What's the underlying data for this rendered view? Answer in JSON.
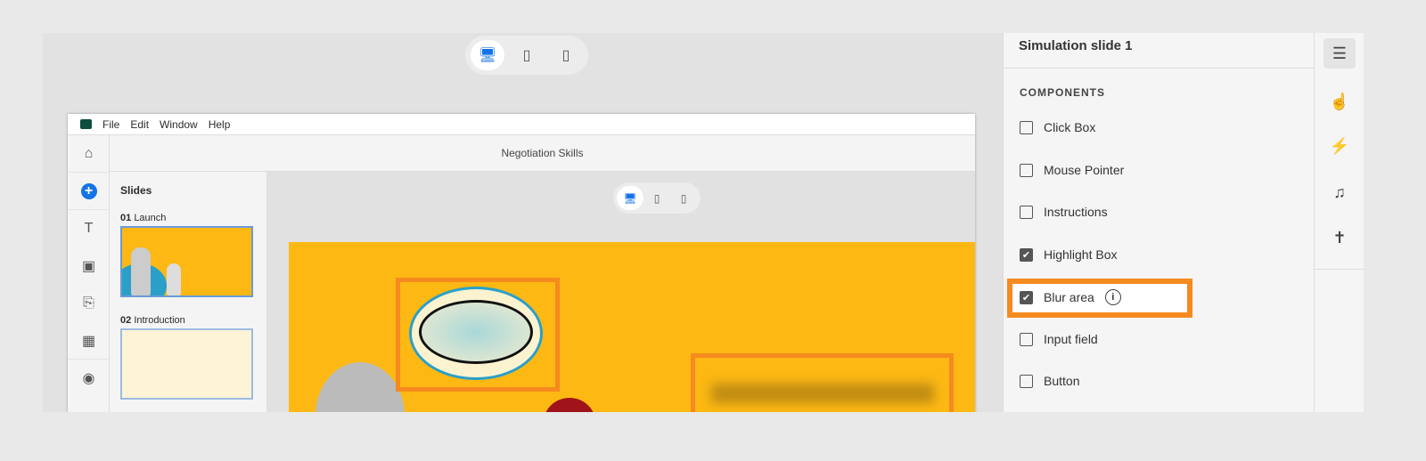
{
  "preview_toggle": {
    "devices": [
      "desktop-icon",
      "tablet-icon",
      "mobile-icon"
    ],
    "selected": "desktop"
  },
  "app": {
    "menu": [
      "File",
      "Edit",
      "Window",
      "Help"
    ],
    "title": "Negotiation Skills",
    "slides_panel": {
      "heading": "Slides",
      "slides": [
        {
          "num": "01",
          "label": "Launch"
        },
        {
          "num": "02",
          "label": "Introduction"
        }
      ]
    }
  },
  "properties": {
    "title": "Simulation slide 1",
    "section": "COMPONENTS",
    "components": [
      {
        "label": "Click Box",
        "checked": false
      },
      {
        "label": "Mouse Pointer",
        "checked": false
      },
      {
        "label": "Instructions",
        "checked": false
      },
      {
        "label": "Highlight Box",
        "checked": true
      },
      {
        "label": "Blur area",
        "checked": true,
        "info": "i"
      },
      {
        "label": "Input field",
        "checked": false
      },
      {
        "label": "Button",
        "checked": false
      }
    ]
  },
  "colors": {
    "highlight": "#f58a1f",
    "slide_bg": "#fdb813",
    "accent": "#1473e6"
  }
}
